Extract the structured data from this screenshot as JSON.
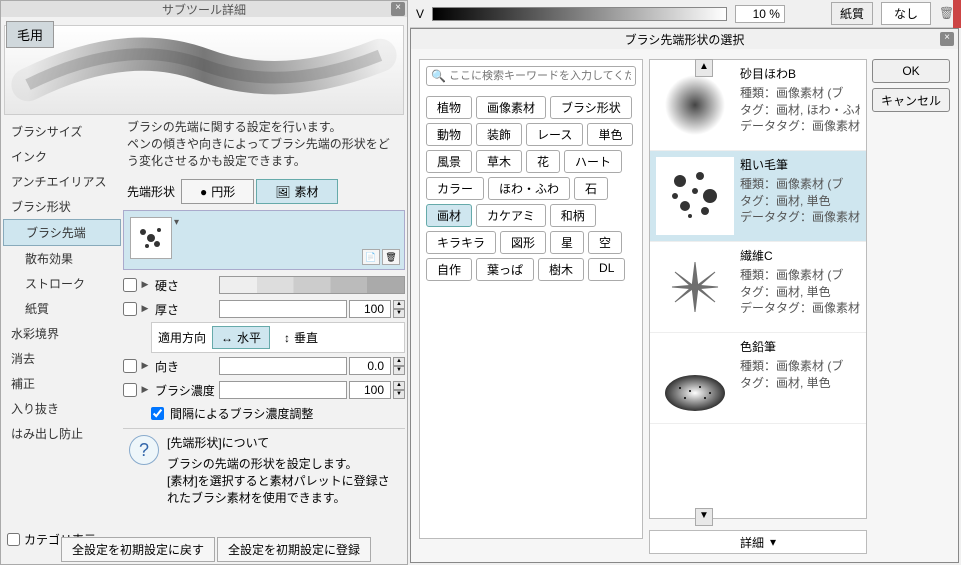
{
  "top": {
    "v_label": "V",
    "percent": "10 %",
    "paper": "紙質",
    "none": "なし"
  },
  "subtool": {
    "title": "サブツール詳細",
    "tab": "毛用",
    "desc": "ブラシの先端に関する設定を行います。\nペンの傾きや向きによってブラシ先端の形状をどう変化させるかも設定できます。",
    "sidebar": [
      "ブラシサイズ",
      "インク",
      "アンチエイリアス",
      "ブラシ形状",
      "ブラシ先端",
      "散布効果",
      "ストローク",
      "紙質",
      "水彩境界",
      "消去",
      "補正",
      "入り抜き",
      "はみ出し防止"
    ],
    "sidebar_selected": 4,
    "tip": {
      "label": "先端形状",
      "circle": "円形",
      "material": "素材"
    },
    "rows": {
      "hardness": {
        "label": "硬さ",
        "value": ""
      },
      "thickness": {
        "label": "厚さ",
        "value": "100"
      },
      "direction": {
        "label": "適用方向",
        "horiz": "水平",
        "vert": "垂直"
      },
      "angle": {
        "label": "向き",
        "value": "0.0"
      },
      "density": {
        "label": "ブラシ濃度",
        "value": "100"
      },
      "interval": {
        "label": "間隔によるブラシ濃度調整"
      }
    },
    "info": {
      "title": "[先端形状]について",
      "body": "ブラシの先端の形状を設定します。\n[素材]を選択すると素材パレットに登録されたブラシ素材を使用できます。"
    },
    "category": "カテゴリ表示",
    "reset": "全設定を初期設定に戻す",
    "register": "全設定を初期設定に登録"
  },
  "dialog": {
    "title": "ブラシ先端形状の選択",
    "search_placeholder": "ここに検索キーワードを入力してくだ…",
    "tags": [
      "植物",
      "画像素材",
      "ブラシ形状",
      "動物",
      "装飾",
      "レース",
      "単色",
      "風景",
      "草木",
      "花",
      "ハート",
      "カラー",
      "ほわ・ふわ",
      "石",
      "画材",
      "カケアミ",
      "和柄",
      "キラキラ",
      "図形",
      "星",
      "空",
      "自作",
      "葉っぱ",
      "樹木",
      "DL"
    ],
    "selected_tag": "画材",
    "materials": [
      {
        "name": "砂目ほわB",
        "type": "種類：画像素材 (ブ",
        "tags": "タグ：画材, ほわ・ふわ",
        "datatag": "データタグ：画像素材"
      },
      {
        "name": "粗い毛筆",
        "type": "種類：画像素材 (ブ",
        "tags": "タグ：画材, 単色",
        "datatag": "データタグ：画像素材"
      },
      {
        "name": "繊維C",
        "type": "種類：画像素材 (ブ",
        "tags": "タグ：画材, 単色",
        "datatag": "データタグ：画像素材"
      },
      {
        "name": "色鉛筆",
        "type": "種類：画像素材 (ブ",
        "tags": "タグ：画材, 単色",
        "datatag": ""
      }
    ],
    "selected_material": 1,
    "detail": "詳細",
    "ok": "OK",
    "cancel": "キャンセル"
  }
}
